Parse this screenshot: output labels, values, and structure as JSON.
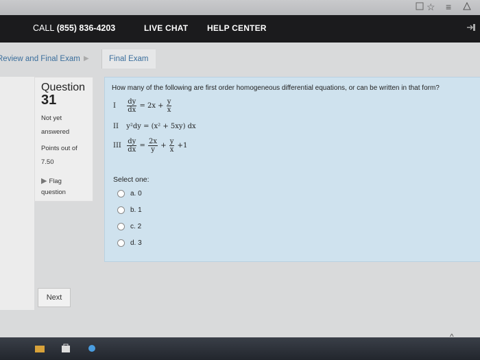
{
  "browser": {
    "url_fragment": "...",
    "icons": [
      "bookmark-icon",
      "star-icon",
      "menu-icon",
      "extension-icon"
    ]
  },
  "header": {
    "call_label": "CALL",
    "phone": "(855) 836-4203",
    "nav": [
      "LIVE CHAT",
      "HELP CENTER"
    ],
    "signout_icon": "sign-out-icon"
  },
  "breadcrumb": {
    "items": [
      "Review and Final Exam",
      "Final Exam"
    ]
  },
  "info": {
    "question_label": "Question",
    "question_number": "31",
    "status_line1": "Not yet",
    "status_line2": "answered",
    "points_label": "Points out of",
    "points_value": "7.50",
    "flag_line1": "Flag",
    "flag_line2": "question"
  },
  "question": {
    "text": "How many of the following are first order homogeneous differential equations, or can be written in that form?",
    "equations": [
      {
        "roman": "I",
        "lhs_num": "dy",
        "lhs_den": "dx",
        "mid": "= 2x +",
        "rhs_num": "y",
        "rhs_den": "x"
      },
      {
        "roman": "II",
        "expr": "y²dy = (x² + 5xy) dx"
      },
      {
        "roman": "III",
        "lhs_num": "dy",
        "lhs_den": "dx",
        "t1_num": "2x",
        "t1_den": "y",
        "t2_num": "y",
        "t2_den": "x",
        "tail": "+1"
      }
    ],
    "select_label": "Select one:",
    "options": [
      {
        "letter": "a.",
        "value": "0"
      },
      {
        "letter": "b.",
        "value": "1"
      },
      {
        "letter": "c.",
        "value": "2"
      },
      {
        "letter": "d.",
        "value": "3"
      }
    ]
  },
  "nav": {
    "next_label": "Next"
  },
  "colors": {
    "header_bg": "#1b1b1d",
    "question_bg": "#cfe2ee",
    "link": "#3a6e9c"
  }
}
